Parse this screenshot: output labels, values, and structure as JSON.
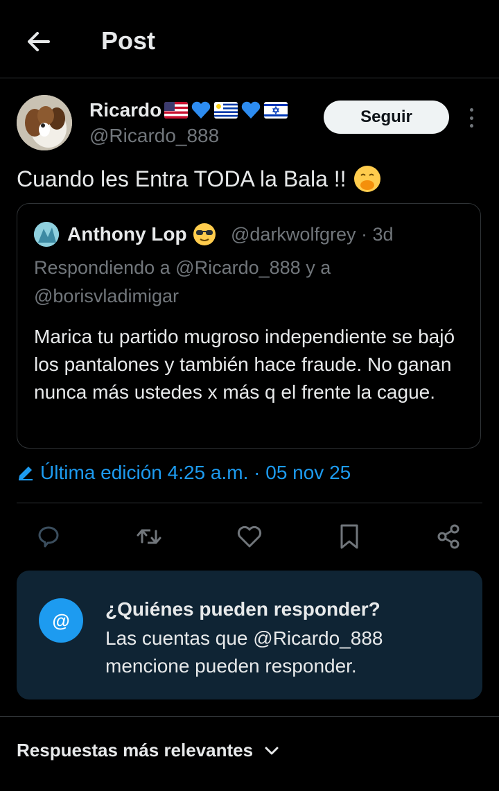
{
  "header": {
    "title": "Post"
  },
  "author": {
    "name": "Ricardo",
    "handle": "@Ricardo_888",
    "follow_label": "Seguir"
  },
  "post": {
    "text": "Cuando les Entra TODA la Bala !!"
  },
  "quote": {
    "name": "Anthony Lop",
    "handle": "@darkwolfgrey",
    "time": "3d",
    "replying_prefix": "Respondiendo a ",
    "replying_user1": "@Ricardo_888",
    "replying_and": " y a",
    "replying_user2": "@borisvladimigar",
    "text": "Marica tu partido mugroso independiente se bajó los pantalones y también hace fraude. No ganan nunca más ustedes x más q el frente la cague."
  },
  "edited": {
    "label": "Última edición 4:25 a.m. · 05 nov 25"
  },
  "reply_restriction": {
    "title": "¿Quiénes pueden responder?",
    "description": "Las cuentas que @Ricardo_888 mencione pueden responder.",
    "icon_text": "@"
  },
  "sort": {
    "label": "Respuestas más relevantes"
  },
  "colors": {
    "background": "#000000",
    "text": "#e7e9ea",
    "muted": "#71767b",
    "accent": "#1d9bf0",
    "border": "#2f3336",
    "card": "#0f2434"
  },
  "icons": [
    "back-arrow-icon",
    "more-vertical-icon",
    "reply-icon",
    "repost-icon",
    "like-icon",
    "bookmark-icon",
    "share-icon",
    "edit-pencil-icon",
    "chevron-down-icon"
  ]
}
